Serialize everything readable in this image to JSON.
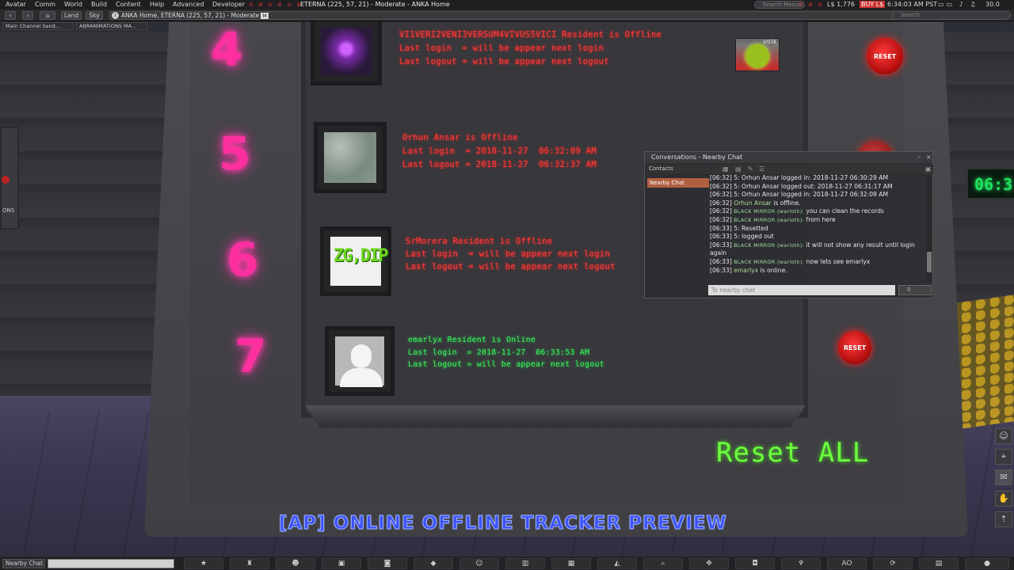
{
  "menubar": {
    "items": [
      "Avatar",
      "Comm",
      "World",
      "Build",
      "Content",
      "Help",
      "Advanced",
      "Developer"
    ],
    "window_title": "ETERNA (225, 57, 21) - Moderate - ANKA Home",
    "search_menus_placeholder": "Search Menus",
    "balance": "L$ 1,776",
    "buy_label": "BUY L$",
    "time": "6:34:03 AM PST",
    "fps": "30.0"
  },
  "navbar": {
    "land_label": "Land",
    "sky_label": "Sky",
    "location": "ANKA Home, ETERNA (225, 57, 21) - Moderate",
    "maturity_badge": "M",
    "search_placeholder": "Search"
  },
  "favorites": [
    "Main Channel Sand...",
    "ABRANIMATIONS MA..."
  ],
  "board": {
    "slots": [
      {
        "number": "4",
        "line1": "VI1VERI2VENI3VERSUM4VIVUS5VICI Resident is Offline",
        "line2": "Last login  = will be appear next login",
        "line3": "Last logout = will be appear next logout",
        "status": "offline"
      },
      {
        "number": "5",
        "line1": "Orhun Ansar is Offline",
        "line2": "Last login  = 2018-11-27  06:32:09 AM",
        "line3": "Last logout = 2018-11-27  06:32:37 AM",
        "status": "offline"
      },
      {
        "number": "6",
        "line1": "SrMorera Resident is Offline",
        "line2": "Last login  = will be appear next login",
        "line3": "Last logout = will be appear next logout",
        "status": "offline"
      },
      {
        "number": "7",
        "line1": "emarlyx Resident is Online",
        "line2": "Last login  = 2018-11-27  06:33:53 AM",
        "line3": "Last logout = will be appear next logout",
        "status": "online"
      }
    ],
    "reset_label": "RESET",
    "reset_all_label": "Reset ALL",
    "clock_text": "06:3",
    "power_label": "VISTA",
    "sign_text": "ONS",
    "tracker_title": "[AP] ONLINE OFFLINE TRACKER PREVIEW",
    "slot6_picture_text": "ZG,DIP"
  },
  "conversations": {
    "title": "Conversations - Nearby Chat",
    "contacts_label": "Contacts",
    "active_tab": "Nearby Chat",
    "messages": [
      {
        "time": "[06:32]",
        "name": "",
        "text": "5: Orhun Ansar logged in: 2018-11-27  06:30:29 AM"
      },
      {
        "time": "[06:32]",
        "name": "",
        "text": "5: Orhun Ansar logged out: 2018-11-27  06:31:17 AM"
      },
      {
        "time": "[06:32]",
        "name": "",
        "text": "5: Orhun Ansar logged in: 2018-11-27  06:32:09 AM"
      },
      {
        "time": "[06:32]",
        "name": "Orhun Ansar",
        "text": " is offline."
      },
      {
        "time": "[06:32]",
        "name": "BLACK MIRROR (warloth):",
        "text": " you can clean the records"
      },
      {
        "time": "[06:32]",
        "name": "BLACK MIRROR (warloth):",
        "text": " from here"
      },
      {
        "time": "[06:33]",
        "name": "",
        "text": "5: Resetted"
      },
      {
        "time": "[06:33]",
        "name": "",
        "text": "5: logged out"
      },
      {
        "time": "[06:33]",
        "name": "BLACK MIRROR (warloth):",
        "text": " it will not show any result until login again"
      },
      {
        "time": "[06:33]",
        "name": "BLACK MIRROR (warloth):",
        "text": " now lets see emarlyx"
      },
      {
        "time": "[06:33]",
        "name": "emarlyx",
        "text": " is online."
      }
    ],
    "input_placeholder": "To nearby chat",
    "channel_value": "0"
  },
  "bottombar": {
    "nearby_chat_label": "Nearby Chat",
    "ao_label": "AO"
  },
  "colors": {
    "offline_text": "#ff3b3b",
    "online_text": "#3cf060",
    "slot_number": "#ff2fa0",
    "reset_all": "#6cff40",
    "tracker_title": "#3e52ff",
    "active_tab": "#b06040"
  }
}
